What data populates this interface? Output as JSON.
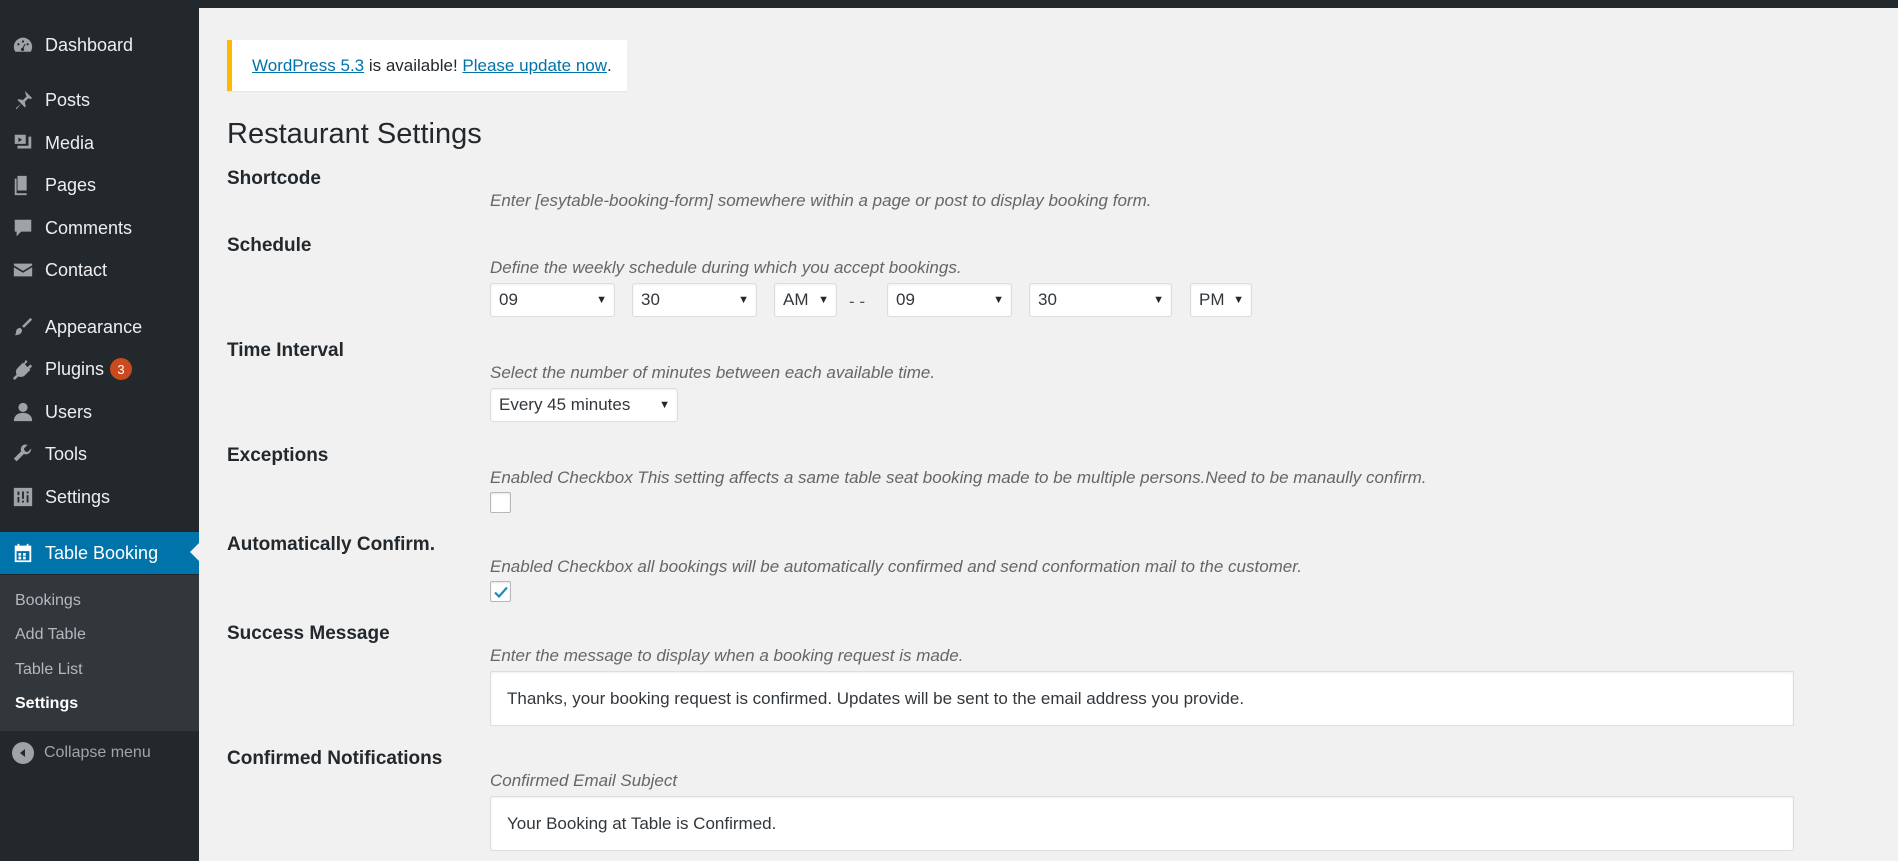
{
  "sidebar": {
    "items": [
      {
        "label": "Dashboard",
        "icon": "dashboard-icon"
      },
      {
        "label": "Posts",
        "icon": "pin-icon"
      },
      {
        "label": "Media",
        "icon": "media-icon"
      },
      {
        "label": "Pages",
        "icon": "pages-icon"
      },
      {
        "label": "Comments",
        "icon": "comment-icon"
      },
      {
        "label": "Contact",
        "icon": "envelope-icon"
      },
      {
        "label": "Appearance",
        "icon": "brush-icon"
      },
      {
        "label": "Plugins",
        "icon": "plug-icon",
        "badge": "3"
      },
      {
        "label": "Users",
        "icon": "user-icon"
      },
      {
        "label": "Tools",
        "icon": "wrench-icon"
      },
      {
        "label": "Settings",
        "icon": "sliders-icon"
      },
      {
        "label": "Table Booking",
        "icon": "calendar-icon",
        "active": true
      }
    ],
    "submenu": [
      {
        "label": "Bookings"
      },
      {
        "label": "Add Table"
      },
      {
        "label": "Table List"
      },
      {
        "label": "Settings",
        "current": true
      }
    ],
    "collapse_label": "Collapse menu"
  },
  "notice": {
    "link1": "WordPress 5.3",
    "middle": " is available! ",
    "link2": "Please update now",
    "end": "."
  },
  "page_title": "Restaurant Settings",
  "sections": {
    "shortcode": {
      "label": "Shortcode",
      "desc": "Enter [esytable-booking-form] somewhere within a page or post to display booking form."
    },
    "schedule": {
      "label": "Schedule",
      "desc": "Define the weekly schedule during which you accept bookings.",
      "start_hour": "09",
      "start_minute": "30",
      "start_period": "AM",
      "separator": "- -",
      "end_hour": "09",
      "end_minute": "30",
      "end_period": "PM"
    },
    "time_interval": {
      "label": "Time Interval",
      "desc": "Select the number of minutes between each available time.",
      "value": "Every 45 minutes"
    },
    "exceptions": {
      "label": "Exceptions",
      "desc": "Enabled Checkbox This setting affects a same table seat booking made to be multiple persons.Need to be manaully confirm.",
      "checked": false
    },
    "auto_confirm": {
      "label": "Automatically Confirm.",
      "desc": "Enabled Checkbox all bookings will be automatically confirmed and send conformation mail to the customer.",
      "checked": true
    },
    "success_message": {
      "label": "Success Message",
      "desc": "Enter the message to display when a booking request is made.",
      "value": "Thanks, your booking request is confirmed. Updates will be sent to the email address you provide."
    },
    "confirmed_notifications": {
      "label": "Confirmed Notifications",
      "desc": "Confirmed Email Subject",
      "value": "Your Booking at Table is Confirmed."
    }
  },
  "colors": {
    "sidebar_bg": "#23282d",
    "active_bg": "#0073aa",
    "notice_border": "#ffb900",
    "badge": "#ca4a1f",
    "link": "#0073aa"
  }
}
